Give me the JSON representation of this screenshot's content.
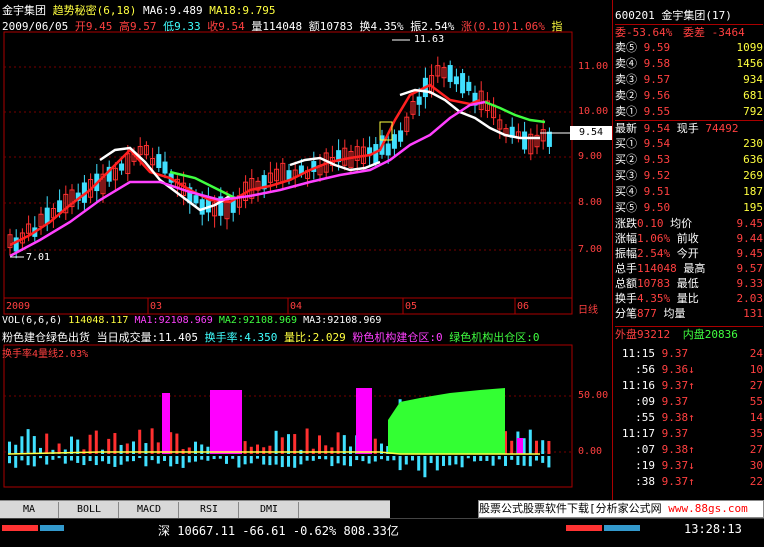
{
  "header": {
    "name": "金宇集团",
    "indicator": "趋势秘密(6,18)",
    "ma6": "MA6:9.489",
    "ma18": "MA18:9.795",
    "date": "2009/06/05",
    "open": "开9.45",
    "high": "高9.57",
    "low": "低9.33",
    "close": "收9.54",
    "volume": "量114048",
    "amount": "额10783",
    "turnover": "换4.35%",
    "amplitude": "振2.54%",
    "change": "涨(0.10)1.06%",
    "extra": "指"
  },
  "annotations": {
    "high_label": "11.63",
    "low_label": "7.01",
    "current_price": "9.54"
  },
  "y_axis_main": [
    "11.00",
    "10.00",
    "9.00",
    "8.00",
    "7.00"
  ],
  "x_axis": [
    "2009",
    "03",
    "04",
    "05",
    "06",
    "日线"
  ],
  "vol_header": {
    "vol": "VOL(6,6,6)",
    "v1": "114048.117",
    "ma1": "MA1:92108.969",
    "ma2": "MA2:92108.969",
    "ma3": "MA3:92108.969",
    "line2a": "粉色建仓绿色出货",
    "line2b": "当日成交量:11.405",
    "line2c": "换手率:4.350",
    "line2d": "量比:2.029",
    "line2e": "粉色机构建仓区:0",
    "line2f": "绿色机构出仓区:0",
    "line3": "换手率4量线2.03%"
  },
  "y_axis_vol": [
    "50.00",
    "0.00"
  ],
  "tabs": [
    "MA",
    "BOLL",
    "MACD",
    "RSI",
    "DMI"
  ],
  "index_bar": {
    "name": "深",
    "value": "10667.11",
    "chg": "-66.61",
    "pct": "-0.62%",
    "amt": "808.33亿"
  },
  "ad_text": "股票公式股票软件下载[分析家公式网",
  "ad_url": "www.88gs.com",
  "clock": "13:28:13",
  "side": {
    "code": "600201",
    "title": "金宇集团(17)",
    "wei_bi": "委-53.64%",
    "wei_cha": "委差 -3464",
    "sells": [
      {
        "label": "卖⑤",
        "price": "9.59",
        "vol": "1099"
      },
      {
        "label": "卖④",
        "price": "9.58",
        "vol": "1456"
      },
      {
        "label": "卖③",
        "price": "9.57",
        "vol": "934"
      },
      {
        "label": "卖②",
        "price": "9.56",
        "vol": "681"
      },
      {
        "label": "卖①",
        "price": "9.55",
        "vol": "792"
      }
    ],
    "latest": {
      "label": "最新",
      "price": "9.54",
      "label2": "现手",
      "vol": "74492"
    },
    "buys": [
      {
        "label": "买①",
        "price": "9.54",
        "vol": "230"
      },
      {
        "label": "买②",
        "price": "9.53",
        "vol": "636"
      },
      {
        "label": "买③",
        "price": "9.52",
        "vol": "269"
      },
      {
        "label": "买④",
        "price": "9.51",
        "vol": "187"
      },
      {
        "label": "买⑤",
        "price": "9.50",
        "vol": "195"
      }
    ],
    "stats": [
      [
        "涨跌",
        "0.10",
        "均价",
        "9.45"
      ],
      [
        "涨幅",
        "1.06%",
        "前收",
        "9.44"
      ],
      [
        "振幅",
        "2.54%",
        "今开",
        "9.45"
      ],
      [
        "总手",
        "114048",
        "最高",
        "9.57"
      ],
      [
        "总额",
        "10783",
        "最低",
        "9.33"
      ],
      [
        "换手",
        "4.35%",
        "量比",
        "2.03"
      ],
      [
        "分笔",
        "877",
        "均量",
        "131"
      ]
    ],
    "outer": "外盘93212",
    "inner": "内盘20836",
    "ticks": [
      {
        "time": "11:15",
        "price": "9.37",
        "vol": "24",
        "dir": ""
      },
      {
        "time": ":56",
        "price": "9.36",
        "vol": "10",
        "dir": "↓"
      },
      {
        "time": "11:16",
        "price": "9.37",
        "vol": "27",
        "dir": "↑"
      },
      {
        "time": ":09",
        "price": "9.37",
        "vol": "55",
        "dir": ""
      },
      {
        "time": ":55",
        "price": "9.38",
        "vol": "14",
        "dir": "↑"
      },
      {
        "time": "11:17",
        "price": "9.37",
        "vol": "35",
        "dir": ""
      },
      {
        "time": ":07",
        "price": "9.38",
        "vol": "27",
        "dir": "↑"
      },
      {
        "time": ":19",
        "price": "9.37",
        "vol": "30",
        "dir": "↓"
      },
      {
        "time": ":38",
        "price": "9.37",
        "vol": "22",
        "dir": "↑"
      }
    ]
  }
}
